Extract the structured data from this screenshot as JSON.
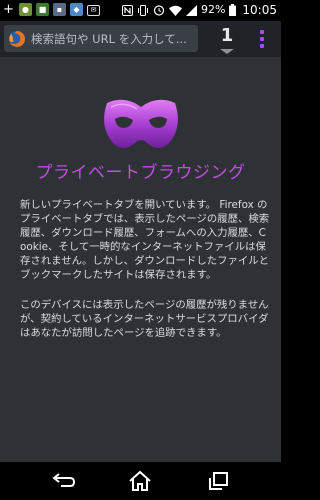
{
  "status_bar": {
    "battery_text": "92%",
    "time": "10:05",
    "notification_icons": [
      "add-icon",
      "android-icon",
      "app-icon",
      "app-icon",
      "app-icon",
      "email-icon"
    ],
    "system_icons": [
      "nfc-icon",
      "vibrate-icon",
      "alarm-icon",
      "wifi-icon",
      "signal-icon",
      "battery-icon"
    ]
  },
  "toolbar": {
    "url_placeholder": "検索語句や URL を入力して...",
    "tab_count": "1",
    "menu_icon": "overflow-menu-icon",
    "accent_color": "#a64dff"
  },
  "content": {
    "title": "プライベートブラウジング",
    "title_color": "#c04ee0",
    "paragraph1": "新しいプライベートタブを開いています。 Firefox のプライベートタブでは、表示したページの履歴、検索履歴、ダウンロード履歴、フォームへの入力履歴、Cookie、そして一時的なインターネットファイルは保存されません。しかし、ダウンロードしたファイルとブックマークしたサイトは保存されます。",
    "paragraph2": "このデバイスには表示したページの履歴が残りませんが、契約しているインターネットサービスプロバイダはあなたが訪問したページを追跡できます。"
  },
  "nav_bar": {
    "icons": [
      "back-icon",
      "home-icon",
      "recent-apps-icon"
    ]
  }
}
